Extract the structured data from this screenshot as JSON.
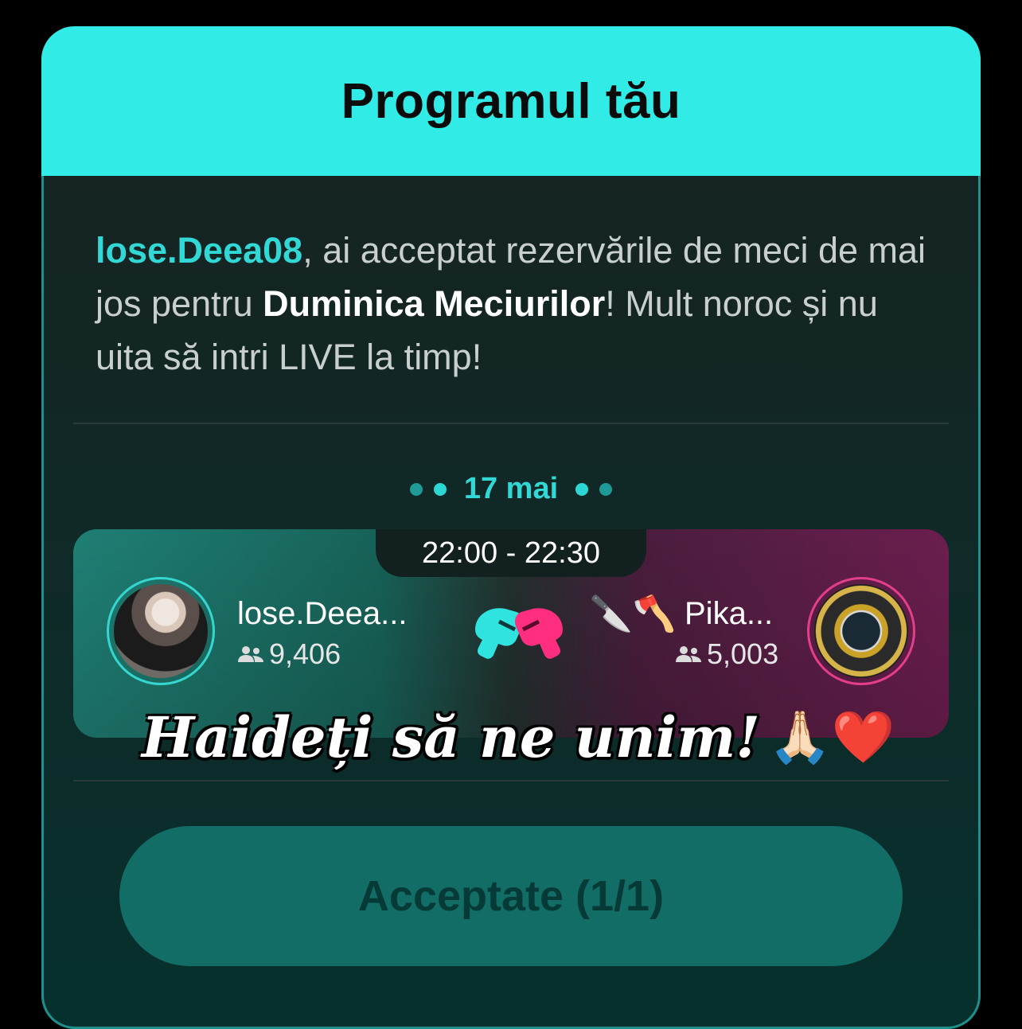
{
  "header": {
    "title": "Programul tău"
  },
  "intro": {
    "username": "lose.Deea08",
    "text_part1": ", ai acceptat rezervările de meci de mai jos pentru ",
    "event": "Duminica Meciurilor",
    "text_part2": "! Mult noroc și nu uita să intri LIVE la timp!"
  },
  "schedule": {
    "date": "17 mai",
    "match": {
      "time": "22:00 - 22:30",
      "left_player": {
        "name": "lose.Deea...",
        "followers": "9,406"
      },
      "right_player": {
        "name": "Pika...",
        "followers": "5,003",
        "emoji_prefix": "🔪🪓"
      }
    }
  },
  "overlay": {
    "slogan": "Haideți să ne unim!",
    "emojis": "🙏🏻❤️"
  },
  "action": {
    "button_label": "Acceptate (1/1)"
  },
  "colors": {
    "accent": "#30ebe6",
    "left_team": "#1f7f74",
    "right_team": "#6b1e4e",
    "button": "#116d66"
  }
}
